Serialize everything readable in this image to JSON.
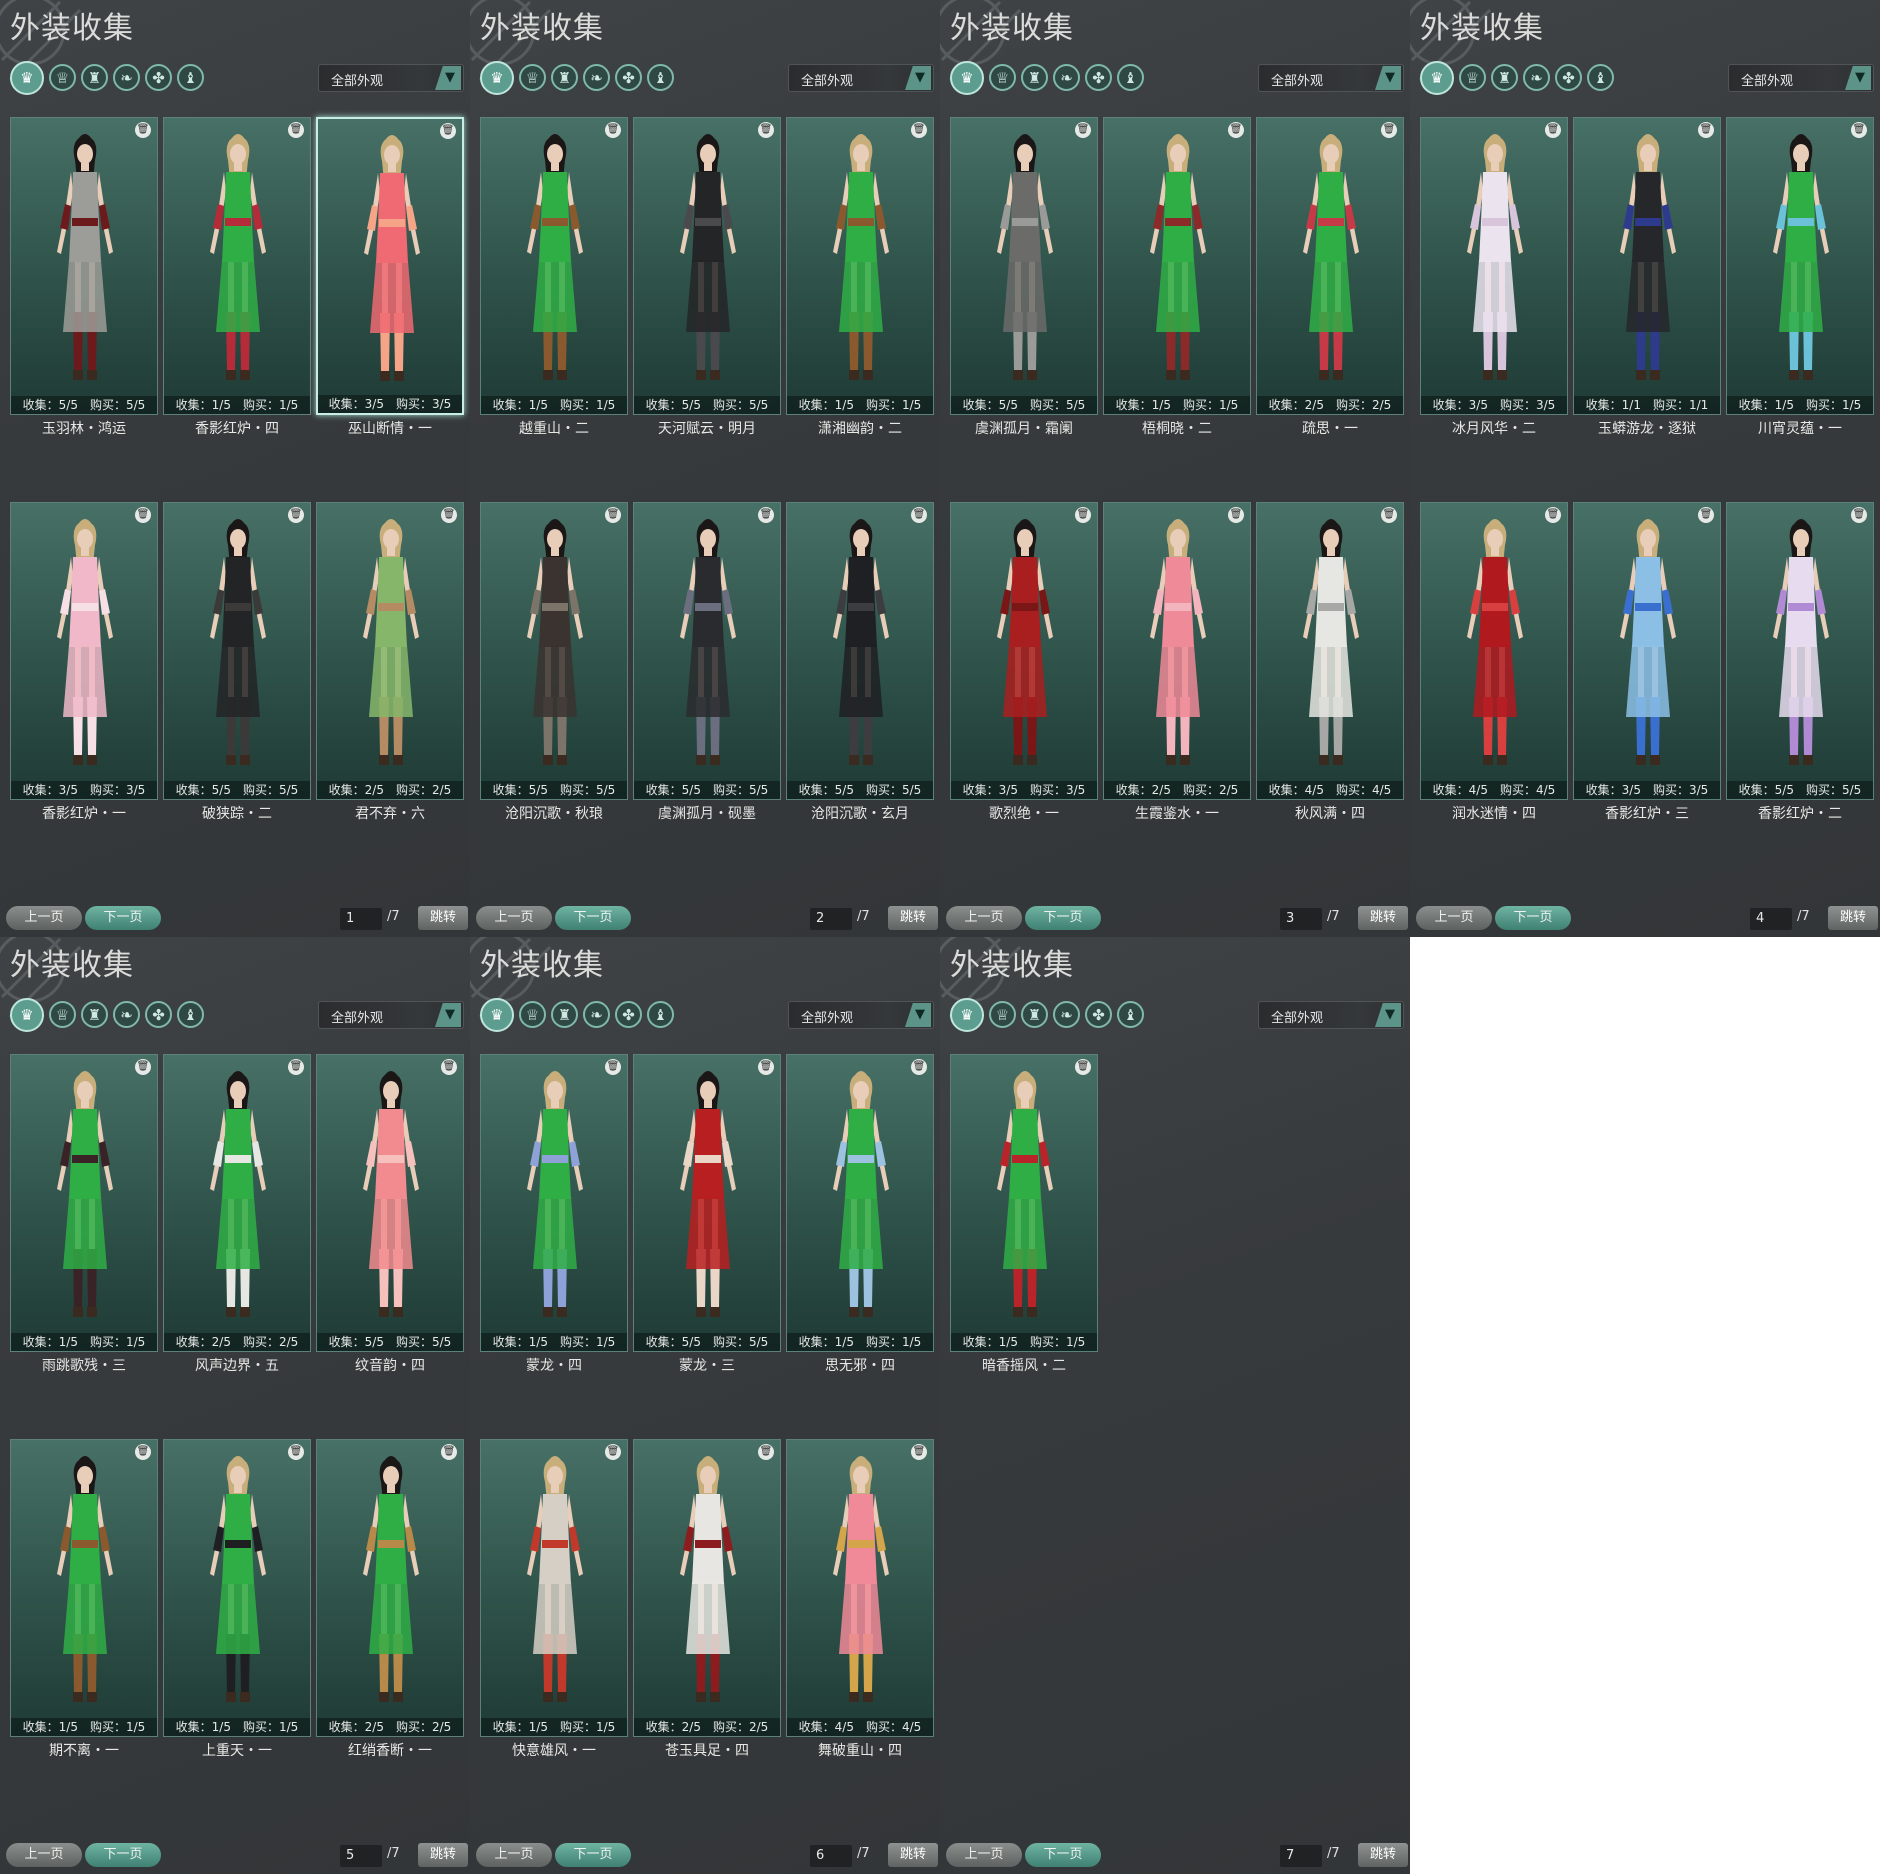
{
  "panels": [
    {
      "title": "外装收集",
      "filter": "全部外观",
      "page": "1",
      "total": "/7",
      "prev": "上一页",
      "next": "下一页",
      "jump": "跳转",
      "selected_index": 2,
      "cards": [
        {
          "name": "玉羽林・鸿运",
          "stats": "收集：5/5　购买：5/5",
          "outfit": "#9c9c98",
          "accent": "#6d1a1c",
          "hair": "#1b1717"
        },
        {
          "name": "香影红炉・四",
          "stats": "收集：1/5　购买：1/5",
          "outfit": "#2fae45",
          "accent": "#b62b3a",
          "hair": "#c7ae7a"
        },
        {
          "name": "巫山断情・一",
          "stats": "收集：3/5　购买：3/5",
          "outfit": "#ef6a72",
          "accent": "#f6a488",
          "hair": "#c7ae7a"
        },
        {
          "name": "香影红炉・一",
          "stats": "收集：3/5　购买：3/5",
          "outfit": "#f0b8c8",
          "accent": "#f7dfe6",
          "hair": "#c7ae7a"
        },
        {
          "name": "破狭踪・二",
          "stats": "收集：5/5　购买：5/5",
          "outfit": "#232426",
          "accent": "#3b3a38",
          "hair": "#1b1717"
        },
        {
          "name": "君不弃・六",
          "stats": "收集：2/5　购买：2/5",
          "outfit": "#86b66a",
          "accent": "#b58b63",
          "hair": "#c7ae7a"
        }
      ]
    },
    {
      "title": "外装收集",
      "filter": "全部外观",
      "page": "2",
      "total": "/7",
      "prev": "上一页",
      "next": "下一页",
      "jump": "跳转",
      "selected_index": -1,
      "cards": [
        {
          "name": "越重山・二",
          "stats": "收集：1/5　购买：1/5",
          "outfit": "#2fae45",
          "accent": "#8a5a2e",
          "hair": "#1b1717"
        },
        {
          "name": "天河赋云・明月",
          "stats": "收集：5/5　购买：5/5",
          "outfit": "#242527",
          "accent": "#4a4a4c",
          "hair": "#1b1717"
        },
        {
          "name": "潇湘幽韵・二",
          "stats": "收集：1/5　购买：1/5",
          "outfit": "#2fae45",
          "accent": "#8a5a2e",
          "hair": "#c7ae7a"
        },
        {
          "name": "沧阳沉歌・秋琅",
          "stats": "收集：5/5　购买：5/5",
          "outfit": "#3a3330",
          "accent": "#7d7469",
          "hair": "#1b1717"
        },
        {
          "name": "虞渊孤月・砚墨",
          "stats": "收集：5/5　购买：5/5",
          "outfit": "#2a2b2e",
          "accent": "#6a6e7e",
          "hair": "#1b1717"
        },
        {
          "name": "沧阳沉歌・玄月",
          "stats": "收集：5/5　购买：5/5",
          "outfit": "#1f2023",
          "accent": "#3d3d40",
          "hair": "#1b1717"
        }
      ]
    },
    {
      "title": "外装收集",
      "filter": "全部外观",
      "page": "3",
      "total": "/7",
      "prev": "上一页",
      "next": "下一页",
      "jump": "跳转",
      "selected_index": -1,
      "cards": [
        {
          "name": "虞渊孤月・霜阑",
          "stats": "收集：5/5　购买：5/5",
          "outfit": "#6b6b6a",
          "accent": "#9a9a98",
          "hair": "#1b1717"
        },
        {
          "name": "梧桐晓・二",
          "stats": "收集：1/5　购买：1/5",
          "outfit": "#2fae45",
          "accent": "#8c2a2a",
          "hair": "#c7ae7a"
        },
        {
          "name": "疏思・一",
          "stats": "收集：2/5　购买：2/5",
          "outfit": "#2fae45",
          "accent": "#c63a48",
          "hair": "#c7ae7a"
        },
        {
          "name": "歌烈绝・一",
          "stats": "收集：3/5　购买：3/5",
          "outfit": "#a91f1f",
          "accent": "#7a1616",
          "hair": "#1b1717"
        },
        {
          "name": "生霞鉴水・一",
          "stats": "收集：2/5　购买：2/5",
          "outfit": "#ef8a98",
          "accent": "#f3b4be",
          "hair": "#c7ae7a"
        },
        {
          "name": "秋风满・四",
          "stats": "收集：4/5　购买：4/5",
          "outfit": "#e6e6e2",
          "accent": "#a7a7a5",
          "hair": "#1b1717"
        }
      ]
    },
    {
      "title": "外装收集",
      "filter": "全部外观",
      "page": "4",
      "total": "/7",
      "prev": "上一页",
      "next": "下一页",
      "jump": "跳转",
      "selected_index": -1,
      "cards": [
        {
          "name": "冰月风华・二",
          "stats": "收集：3/5　购买：3/5",
          "outfit": "#ebe3ee",
          "accent": "#d8c4db",
          "hair": "#c7ae7a"
        },
        {
          "name": "玉蟒游龙・逐狱",
          "stats": "收集：1/1　购买：1/1",
          "outfit": "#26272a",
          "accent": "#2e3a8c",
          "hair": "#c7ae7a"
        },
        {
          "name": "川宵灵蕴・一",
          "stats": "收集：1/5　购买：1/5",
          "outfit": "#2fae45",
          "accent": "#6ac1d8",
          "hair": "#1b1717"
        },
        {
          "name": "润水迷情・四",
          "stats": "收集：4/5　购买：4/5",
          "outfit": "#b0191e",
          "accent": "#d84040",
          "hair": "#c7ae7a"
        },
        {
          "name": "香影红炉・三",
          "stats": "收集：3/5　购买：3/5",
          "outfit": "#8cbfe6",
          "accent": "#3a6fd0",
          "hair": "#c7ae7a"
        },
        {
          "name": "香影红炉・二",
          "stats": "收集：5/5　购买：5/5",
          "outfit": "#e7dcef",
          "accent": "#b08ad2",
          "hair": "#1b1717"
        }
      ]
    },
    {
      "title": "外装收集",
      "filter": "全部外观",
      "page": "5",
      "total": "/7",
      "prev": "上一页",
      "next": "下一页",
      "jump": "跳转",
      "selected_index": -1,
      "cards": [
        {
          "name": "雨跳歌残・三",
          "stats": "收集：1/5　购买：1/5",
          "outfit": "#2fae45",
          "accent": "#3a2326",
          "hair": "#c7ae7a"
        },
        {
          "name": "风声边界・五",
          "stats": "收集：2/5　购买：2/5",
          "outfit": "#2fae45",
          "accent": "#e6e6e2",
          "hair": "#1b1717"
        },
        {
          "name": "纹音韵・四",
          "stats": "收集：5/5　购买：5/5",
          "outfit": "#f28b8f",
          "accent": "#f6c0bd",
          "hair": "#1b1717"
        },
        {
          "name": "期不离・一",
          "stats": "收集：1/5　购买：1/5",
          "outfit": "#2fae45",
          "accent": "#8a5a2e",
          "hair": "#1b1717"
        },
        {
          "name": "上重天・一",
          "stats": "收集：1/5　购买：1/5",
          "outfit": "#2fae45",
          "accent": "#1f1f22",
          "hair": "#c7ae7a"
        },
        {
          "name": "红绡香断・一",
          "stats": "收集：2/5　购买：2/5",
          "outfit": "#2fae45",
          "accent": "#b88a4a",
          "hair": "#1b1717"
        }
      ]
    },
    {
      "title": "外装收集",
      "filter": "全部外观",
      "page": "6",
      "total": "/7",
      "prev": "上一页",
      "next": "下一页",
      "jump": "跳转",
      "selected_index": -1,
      "cards": [
        {
          "name": "蒙龙・四",
          "stats": "收集：1/5　购买：1/5",
          "outfit": "#2fae45",
          "accent": "#8fa2d8",
          "hair": "#c7ae7a"
        },
        {
          "name": "蒙龙・三",
          "stats": "收集：5/5　购买：5/5",
          "outfit": "#b81f20",
          "accent": "#e9d6c6",
          "hair": "#1b1717"
        },
        {
          "name": "思无邪・四",
          "stats": "收集：1/5　购买：1/5",
          "outfit": "#2fae45",
          "accent": "#9cc2e0",
          "hair": "#c7ae7a"
        },
        {
          "name": "快意雄风・一",
          "stats": "收集：1/5　购买：1/5",
          "outfit": "#d6cfc6",
          "accent": "#c0392b",
          "hair": "#c7ae7a"
        },
        {
          "name": "苍玉具足・四",
          "stats": "收集：2/5　购买：2/5",
          "outfit": "#e8e6e2",
          "accent": "#8d1c1e",
          "hair": "#c7ae7a"
        },
        {
          "name": "舞破重山・四",
          "stats": "收集：4/5　购买：4/5",
          "outfit": "#f08a98",
          "accent": "#d4a54b",
          "hair": "#c7ae7a"
        }
      ]
    },
    {
      "title": "外装收集",
      "filter": "全部外观",
      "page": "7",
      "total": "/7",
      "prev": "上一页",
      "next": "下一页",
      "jump": "跳转",
      "selected_index": -1,
      "cards": [
        {
          "name": "暗香摇风・二",
          "stats": "收集：1/5　购买：1/5",
          "outfit": "#2fae45",
          "accent": "#b8242a",
          "hair": "#c7ae7a"
        }
      ]
    }
  ]
}
